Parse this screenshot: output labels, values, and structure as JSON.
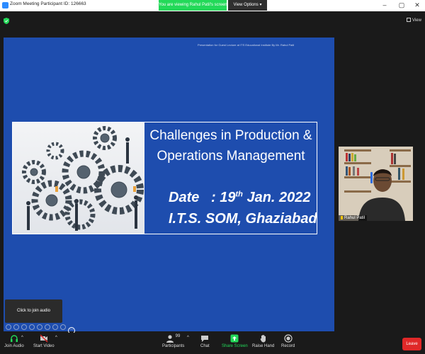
{
  "window": {
    "title": "Zoom Meeting Participant ID: 126663",
    "share_banner": "You are viewing Rahul Patil's screen",
    "view_options": "View Options",
    "top_right_view": "View"
  },
  "slide": {
    "credit": "Presentation for Guest Lecture at ITS Educational Institute By Mr. Rahul Patil",
    "title_line1": "Challenges in Production &",
    "title_line2": "Operations Management",
    "date_label": "Date",
    "date_value": ": 19",
    "date_suffix": "th",
    "date_rest": " Jan. 2022",
    "venue": "I.T.S. SOM, Ghaziabad"
  },
  "participant": {
    "name": "Rahul Patil"
  },
  "audio_tip": "Click to join audio",
  "toolbar": {
    "join_audio": "Join Audio",
    "start_video": "Start Video",
    "participants": "Participants",
    "participants_count": "99",
    "chat": "Chat",
    "share_screen": "Share Screen",
    "raise_hand": "Raise Hand",
    "record": "Record",
    "leave": "Leave"
  },
  "colors": {
    "slide_bg": "#1e4dae",
    "share_green": "#23d959",
    "leave_red": "#e02828"
  }
}
